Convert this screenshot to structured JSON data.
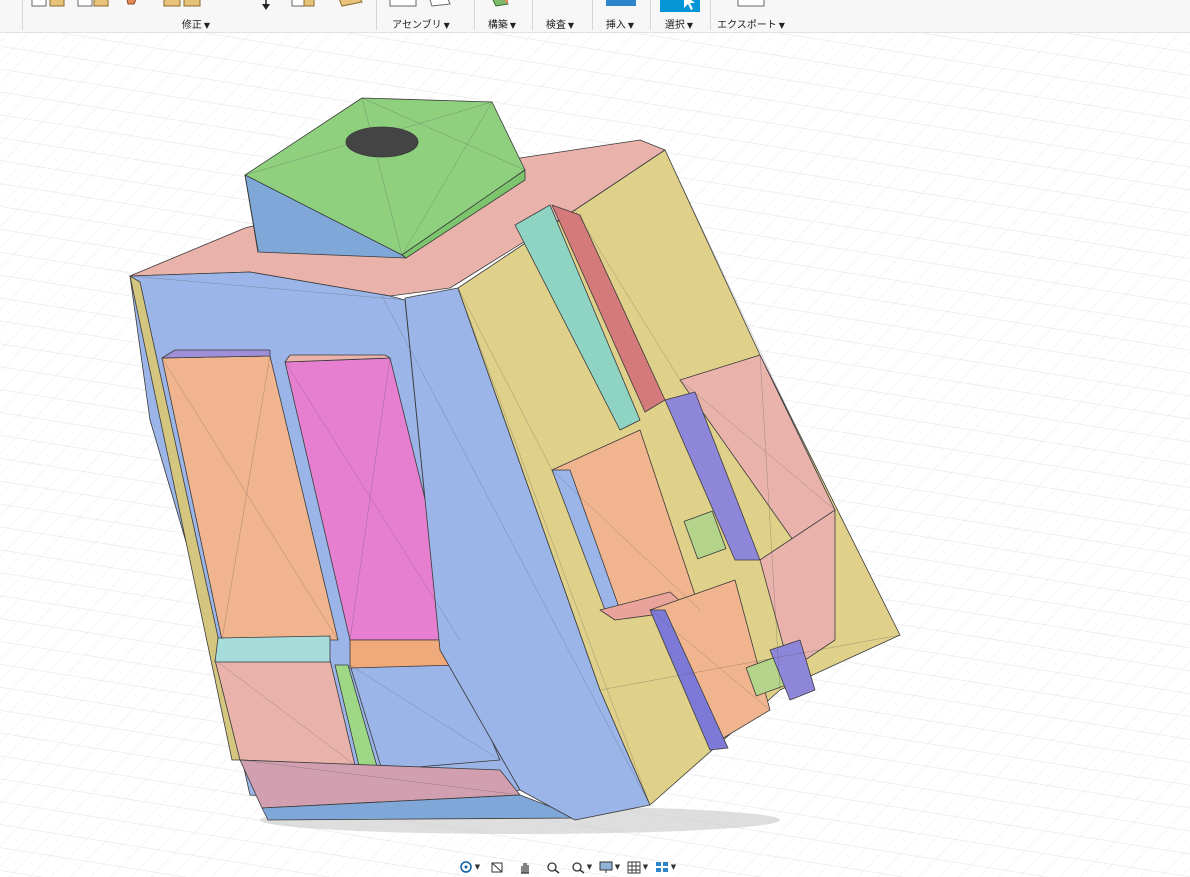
{
  "toolbar": {
    "groups": [
      {
        "label": "修正",
        "icons": [
          "press-pull-icon",
          "fillet-icon",
          "chamfer-icon",
          "shell-icon",
          "move-icon",
          "align-icon",
          "split-icon"
        ]
      },
      {
        "label": "アセンブリ",
        "icons": [
          "new-component-icon",
          "joint-icon"
        ]
      },
      {
        "label": "構築",
        "icons": [
          "plane-icon"
        ]
      },
      {
        "label": "検査",
        "icons": [
          "measure-icon"
        ]
      },
      {
        "label": "挿入",
        "icons": [
          "insert-icon"
        ]
      },
      {
        "label": "選択",
        "icons": [
          "select-cursor-icon"
        ]
      },
      {
        "label": "エクスポート",
        "icons": [
          "export-icon"
        ]
      }
    ],
    "active_group": "選択",
    "accent_color": "#0696d7"
  },
  "viewport": {
    "background": "#ffffff",
    "grid_color": "#d9d9d9",
    "model": "3d-mesh-part"
  },
  "navigation_bar": {
    "buttons": [
      "orbit-icon",
      "look-at-icon",
      "pan-icon",
      "zoom-icon",
      "zoom-window-icon",
      "display-settings-icon",
      "grid-settings-icon",
      "viewports-icon"
    ]
  }
}
